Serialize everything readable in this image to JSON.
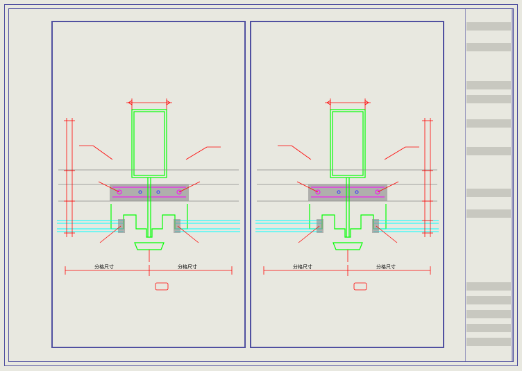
{
  "drawing": {
    "type": "CAD technical drawing",
    "views": 2,
    "labels": {
      "dim_left": "分格尺寸",
      "dim_right": "分格尺寸"
    },
    "colors": {
      "profile": "#00ff00",
      "dimension": "#ff0000",
      "centerline": "#ff00ff",
      "glass": "#00ffff",
      "frame": "#5050a0",
      "steel": "#888888"
    }
  }
}
